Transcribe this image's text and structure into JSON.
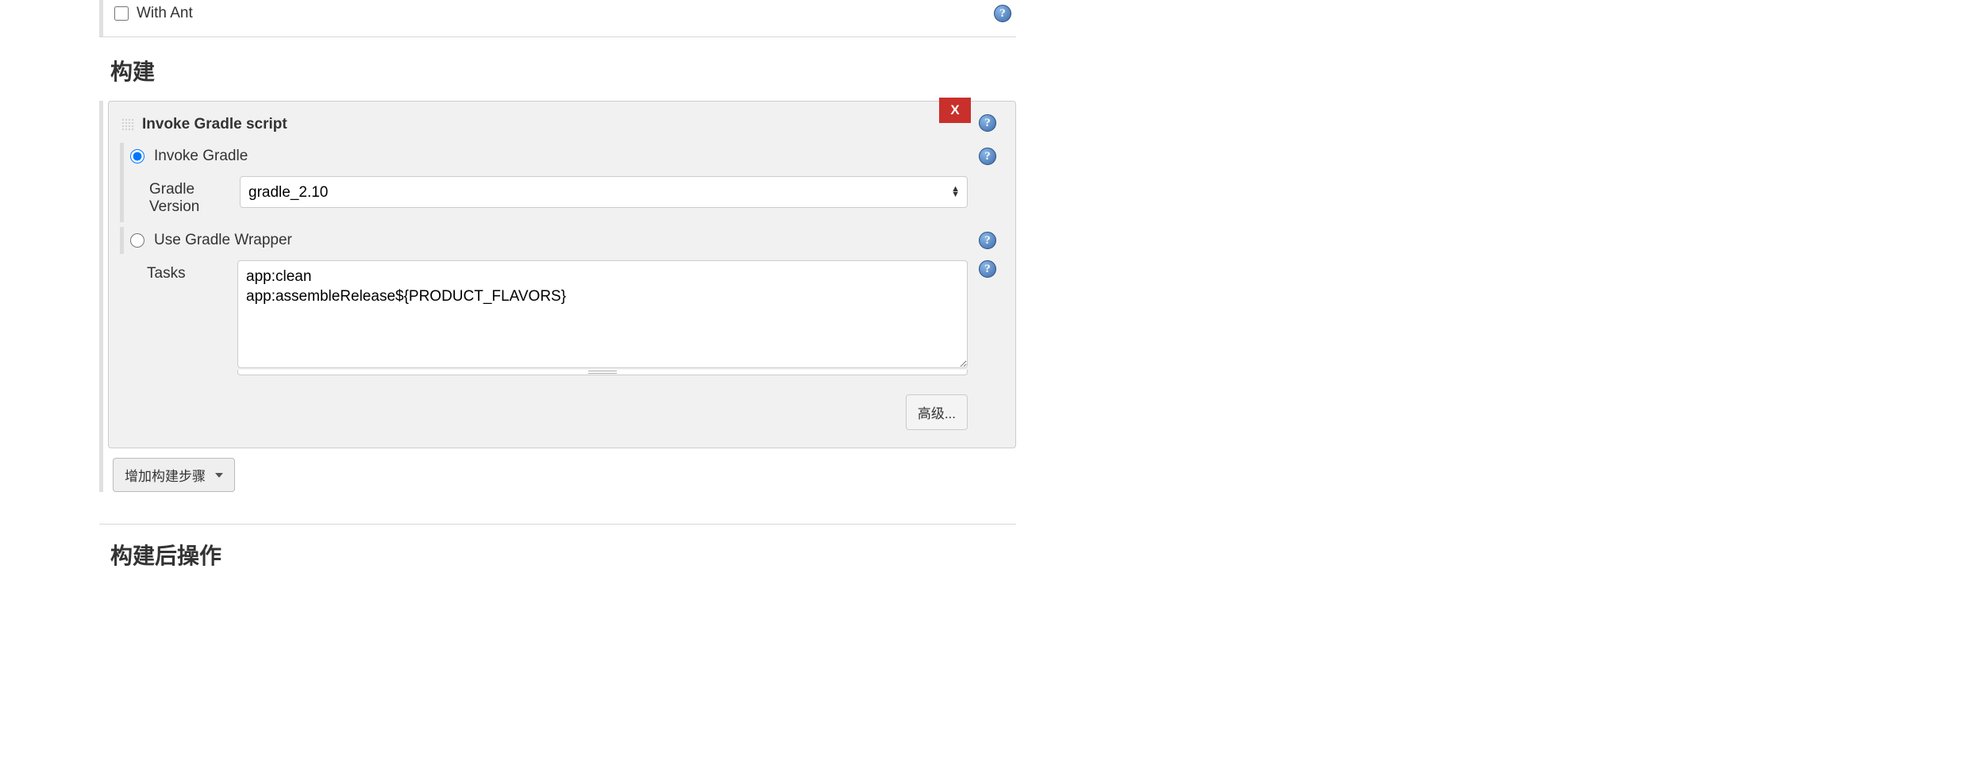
{
  "withAnt": {
    "label": "With Ant"
  },
  "buildSection": {
    "heading": "构建"
  },
  "gradleStep": {
    "title": "Invoke Gradle script",
    "deleteLabel": "X",
    "invokeGradle": {
      "label": "Invoke Gradle"
    },
    "gradleVersion": {
      "label": "Gradle Version",
      "selected": "gradle_2.10"
    },
    "useWrapper": {
      "label": "Use Gradle Wrapper"
    },
    "tasks": {
      "label": "Tasks",
      "value": "app:clean\napp:assembleRelease${PRODUCT_FLAVORS}"
    },
    "advancedLabel": "高级..."
  },
  "addBuildStep": {
    "label": "增加构建步骤"
  },
  "postBuildSection": {
    "heading": "构建后操作"
  }
}
